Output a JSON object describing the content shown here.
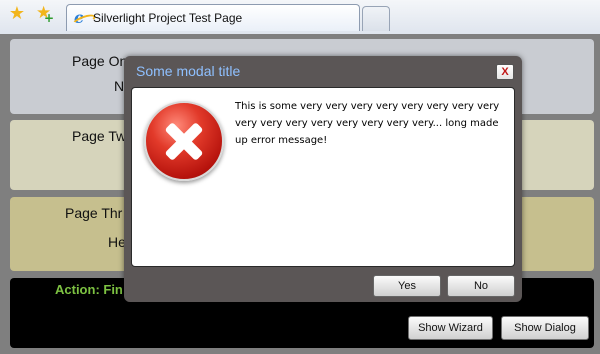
{
  "browser": {
    "tab_title": "Silverlight Project Test Page",
    "icons": [
      "favorites-star-icon",
      "add-favorite-icon",
      "ie-icon"
    ]
  },
  "page": {
    "panels": [
      {
        "line1": "Page One",
        "line2": "N"
      },
      {
        "line1": "Page Tw"
      },
      {
        "line1": "Page Thr",
        "line2": "He"
      }
    ],
    "action_label": "Action: Fin",
    "buttons": {
      "show_wizard": "Show Wizard",
      "show_dialog": "Show Dialog"
    }
  },
  "modal": {
    "title": "Some modal title",
    "close_label": "X",
    "message": "This is some very very very very very very very very very very very very very very very very... long made up error message!",
    "icon": "error-icon",
    "yes_label": "Yes",
    "no_label": "No"
  },
  "colors": {
    "modal_title": "#8fc0ff",
    "action_text": "#7dc242",
    "error_icon": "#d62a1e"
  }
}
